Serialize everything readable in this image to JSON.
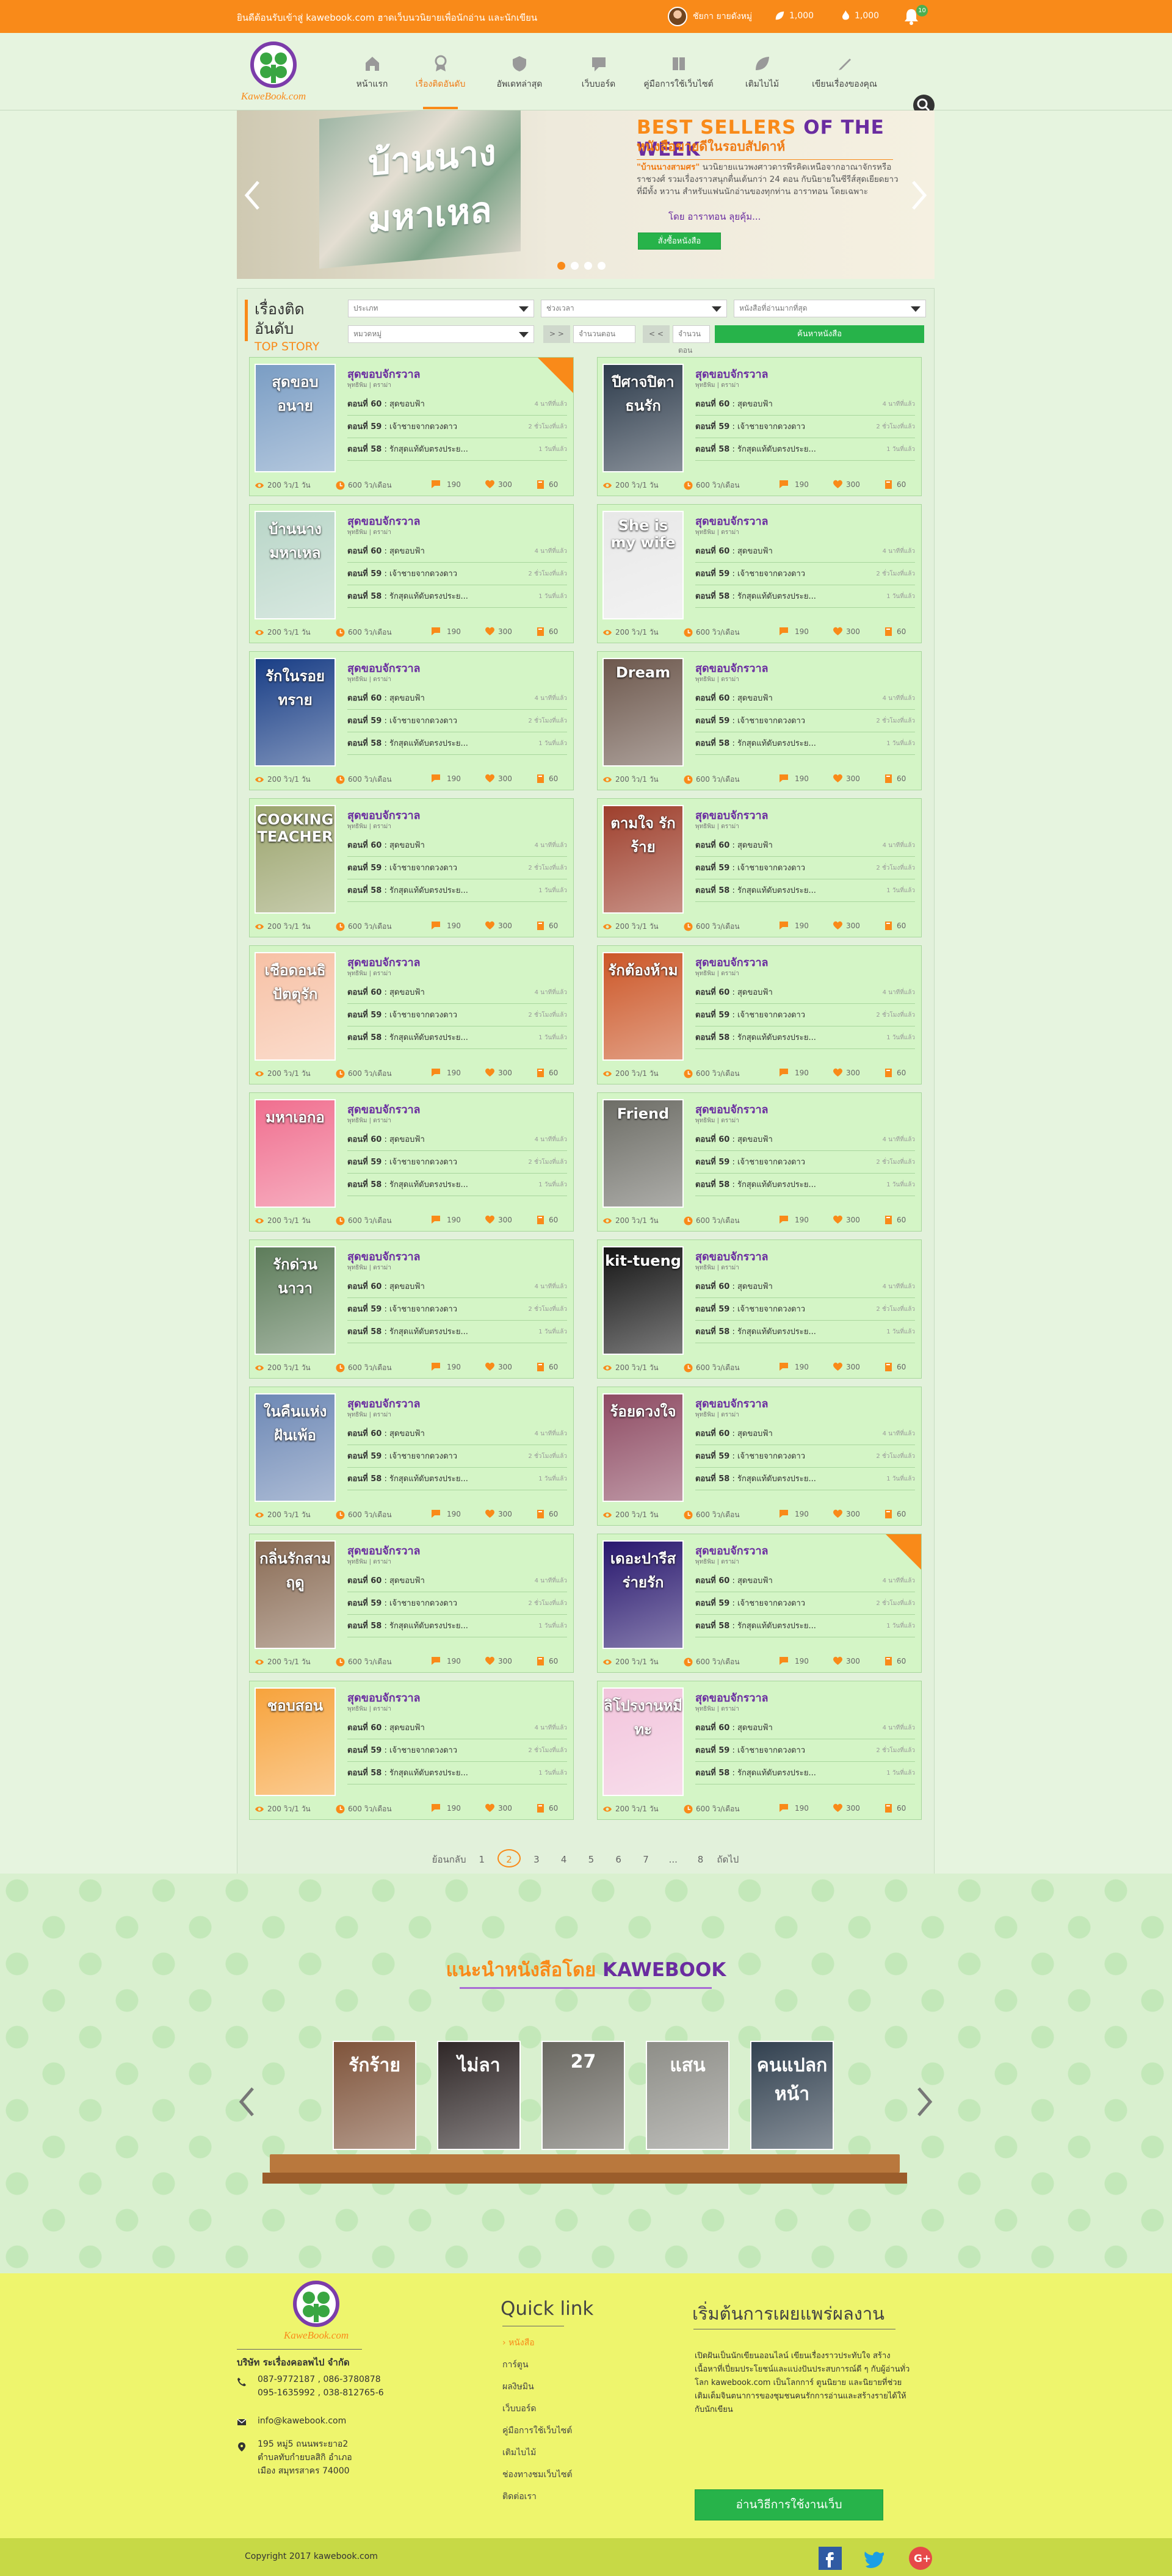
{
  "topbar": {
    "welcome": "ยินดีต้อนรับเข้าสู่ kawebook.com ฮาดเว็บนวนิยายเพื่อนักอ่าน และนักเขียน",
    "user": "ชัยกา ยายดังหมู่",
    "coins": "1,000",
    "points": "1,000",
    "notifications": "10"
  },
  "nav": [
    {
      "label": "หน้าแรก",
      "icon": "house-icon"
    },
    {
      "label": "เรื่องติดอันดับ",
      "icon": "award-icon"
    },
    {
      "label": "อัพเดทล่าสุด",
      "icon": "shield-icon"
    },
    {
      "label": "เว็บบอร์ด",
      "icon": "chat-icon"
    },
    {
      "label": "คู่มือการใช้เว็บไซต์",
      "icon": "book-icon"
    },
    {
      "label": "เติมไบไม้",
      "icon": "leaf-icon"
    },
    {
      "label": "เขียนเรื่องของคุณ",
      "icon": "pen-icon"
    }
  ],
  "banner": {
    "title_orange": "BEST SELLERS",
    "title_purple": " OF THE WEEK",
    "subtitle": "หนังสือขายดีในรอบสัปดาห์",
    "text_lead": "\"บ้านนางสามศร\"",
    "text": "นวนิยายแนวพงศาวดารพีรคิดเหนือจากอาณาจักรหรือราชวงศ์ รวมเรื่องราวสนุกตื่นเต้นกว่า 24 ตอน กับนิยายในซีรีส์สุดเยียดยาวที่มีทั้ง หวาน สำหรับแฟนนักอ่านของทุกท่าน อาราทอน โดยเฉพาะ",
    "author": "โดย อาราทอน ลุยคุ้ม...",
    "button": "สั่งซื้อหนังสือ"
  },
  "top_story": {
    "title": "เรื่องติดอันดับ",
    "subtitle": "TOP STORY",
    "filters": [
      "ประเภท",
      "ช่วงเวลา",
      "หนังสือที่อ่านมากที่สุด",
      "หมวดหมู่"
    ],
    "more": "> >",
    "min": "จำนวนตอน",
    "less": "< <",
    "max": "จำนวนตอน",
    "search": "ค้นหาหนังสือ"
  },
  "card": {
    "title": "สุดขอบจักรวาล",
    "author": "พุทธิพิม | ดราม่า",
    "ep60": "ตอนที่ 60",
    "ep60_title": " : สุดขอบฟ้า",
    "ep59": "ตอนที่ 59",
    "ep59_title": " : เจ้าชายจากดวงดาว",
    "ep58": "ตอนที่ 58",
    "ep58_title": " : รักสุดแท้ดับตรงประย...",
    "d1": "4 นาทีที่แล้ว",
    "d2": "2 ชั่วโมงที่แล้ว",
    "d3": "1 วันที่แล้ว",
    "views": "200 วิว/1 วัน",
    "leaf": "600 วิว/เดือน",
    "comments": "190",
    "likes": "300",
    "pages": "60"
  },
  "books_left": [
    {
      "title": "สุดขอบ อนาย",
      "color": "#7a9dc4"
    },
    {
      "title": "บ้านนาง มหาเหล",
      "color": "#b9d6c8"
    },
    {
      "title": "รักในรอยทราย",
      "color": "#193e86"
    },
    {
      "title": "COOKING TEACHER",
      "color": "#9ba46d"
    },
    {
      "title": "เชือดอนธิ ปัตตุรัก",
      "color": "#f7c1a5"
    },
    {
      "title": "มหาเอกอ",
      "color": "#f06f8f"
    },
    {
      "title": "รักด่วนนาวา",
      "color": "#5d7c5a"
    },
    {
      "title": "ในคืนแห่งฝันเพ้อ",
      "color": "#6d88b5"
    },
    {
      "title": "กลิ่นรักสามฤดู",
      "color": "#8a6c55"
    },
    {
      "title": "ชอบสอน",
      "color": "#f7a33c"
    }
  ],
  "books_right": [
    {
      "title": "ปีศาจปิตาธนรัก",
      "color": "#2e3c4c"
    },
    {
      "title": "She is my wife",
      "color": "#e8e8e8"
    },
    {
      "title": "Dream",
      "color": "#6d584d"
    },
    {
      "title": "ตามใจ รักร้าย",
      "color": "#9e3f2c"
    },
    {
      "title": "รักต้องห้าม",
      "color": "#cc5728"
    },
    {
      "title": "Friend",
      "color": "#6d6d66"
    },
    {
      "title": "kit-tueng",
      "color": "#151515"
    },
    {
      "title": "ร้อยดวงใจ",
      "color": "#8e4b63"
    },
    {
      "title": "เดอะปารีส ร่ายรัก",
      "color": "#28176e"
    },
    {
      "title": "ลิโปรงานหมีทะ",
      "color": "#f2c4dc"
    }
  ],
  "pager": {
    "prev": "ย้อนกลับ",
    "pages": [
      "1",
      "2",
      "3",
      "4",
      "5",
      "6",
      "7",
      "...",
      "8"
    ],
    "next": "ถัดไป"
  },
  "recommend": {
    "prefix": "แนะนำหนังสือโดย ",
    "brand": "KAWEBOOK",
    "books": [
      {
        "title": "รักร้าย",
        "color": "#7f543b"
      },
      {
        "title": "ไม่ลา",
        "color": "#2f2727"
      },
      {
        "title": "27",
        "color": "#696760"
      },
      {
        "title": "แสน",
        "color": "#8e8e88"
      },
      {
        "title": "คนแปลกหน้า",
        "color": "#324150"
      }
    ]
  },
  "footer": {
    "company": "บริษัท ระเรื่องคอลพไป จำกัด",
    "phone1": "087-9772187 , 086-3780878",
    "phone2": "095-1635992 , 038-812765-6",
    "email": "info@kawebook.com",
    "address": "195 หมู่5 ถนนพระยาอ2 ตำบลทับกำยบลสิกิ อำเภอเมือง สมุทรสาคร 74000",
    "quicklink_title": "Quick link",
    "quicklinks": [
      "หนังสือ",
      "การ์ตูน",
      "ผลงิษมิน",
      "เว็บบอร์ด",
      "คู่มือการใช้เว็บไซต์",
      "เติมไบไม้",
      "ช่องทางชมเว็บไซต์",
      "ติดต่อเรา"
    ],
    "publish_title": "เริ่มต้นการเผยแพร่ผลงาน",
    "publish_text": "เปิดฝันเป็นนักเขียนออนไลน์ เขียนเรื่องราวประทับใจ สร้างเนื้อหาที่เปี่ยมประโยชน์และแบ่งปันประสบการณ์ดี ๆ กับผู้อ่านทั่วโลก kawebook.com เป็นโลกการ์ ตูนนิยาย และนิยายที่ช่วยเติมเต็มจินตนาการของชุมชนคนรักการอ่านและสร้างรายได้ให้กับนักเขียน",
    "button": "อ่านวิธีการใช้งานเว็บ"
  },
  "copyright": "Copyright 2017 kawebook.com"
}
